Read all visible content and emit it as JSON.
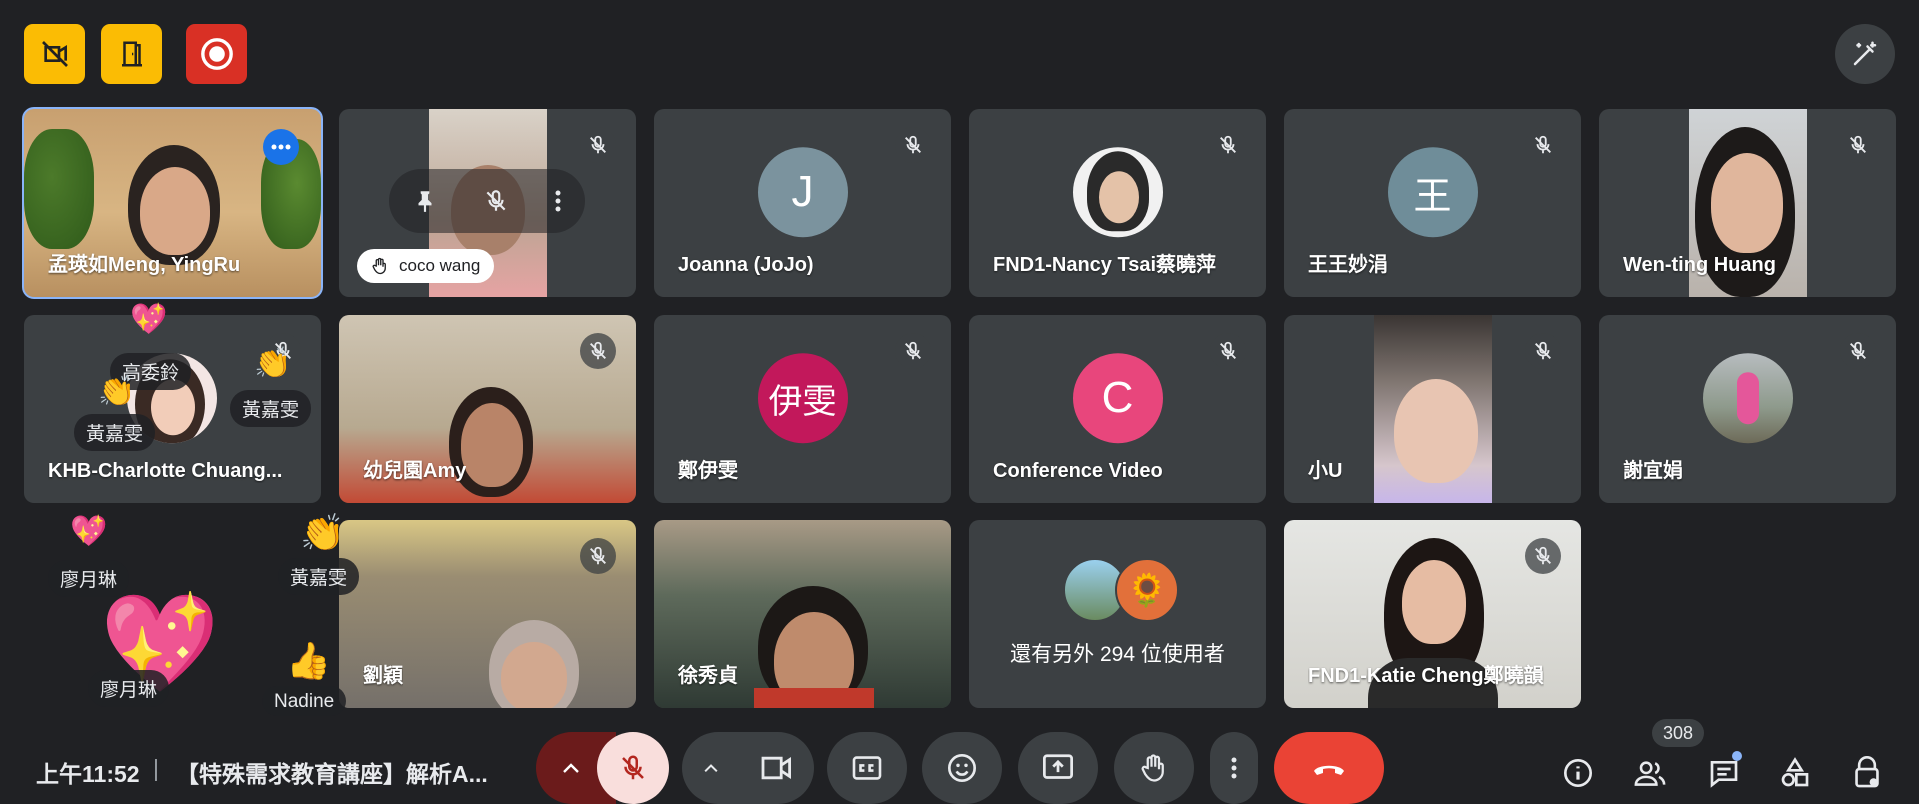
{
  "topbar": {
    "icons": [
      "no-recording-icon",
      "door-icon",
      "record-icon",
      "magic-wand-icon"
    ],
    "colors": {
      "yellow": "#fbbc04",
      "red": "#d93025"
    }
  },
  "tiles": {
    "t1": {
      "name": "孟瑛如Meng, YingRu"
    },
    "t2": {
      "hand_label": "coco wang"
    },
    "t3": {
      "name": "Joanna (JoJo)",
      "initial": "J",
      "color": "#7b939e"
    },
    "t4": {
      "name": "FND1-Nancy Tsai蔡曉萍"
    },
    "t5": {
      "name": "王王妙涓",
      "initial": "王",
      "color": "#6f8d99"
    },
    "t6": {
      "name": "Wen-ting Huang"
    },
    "t7": {
      "name": "KHB-Charlotte Chuang..."
    },
    "t8": {
      "name": "幼兒園Amy"
    },
    "t9": {
      "name": "鄭伊雯",
      "initial": "伊雯",
      "color": "#c2185b"
    },
    "t10": {
      "name": "Conference Video",
      "initial": "C",
      "color": "#e8467c"
    },
    "t11": {
      "name": "小U"
    },
    "t12": {
      "name": "謝宜娟"
    },
    "t13": {
      "name": "劉穎"
    },
    "t14": {
      "name": "徐秀貞"
    },
    "t15": {
      "others": "還有另外 294 位使用者"
    },
    "t16": {
      "name": "FND1-Katie Cheng鄭曉韻"
    }
  },
  "reactions": {
    "r1": "高委鈴",
    "r2": "黃嘉雯",
    "r3": "黃嘉雯",
    "r4": "黃嘉雯",
    "r5": "廖月琳",
    "r6": "廖月琳",
    "r7": "Nadine"
  },
  "bottombar": {
    "time": "上午11:52",
    "separator": "|",
    "title": "【特殊需求教育講座】解析A...",
    "chat_badge": "308",
    "end_call_color": "#ea4335"
  }
}
